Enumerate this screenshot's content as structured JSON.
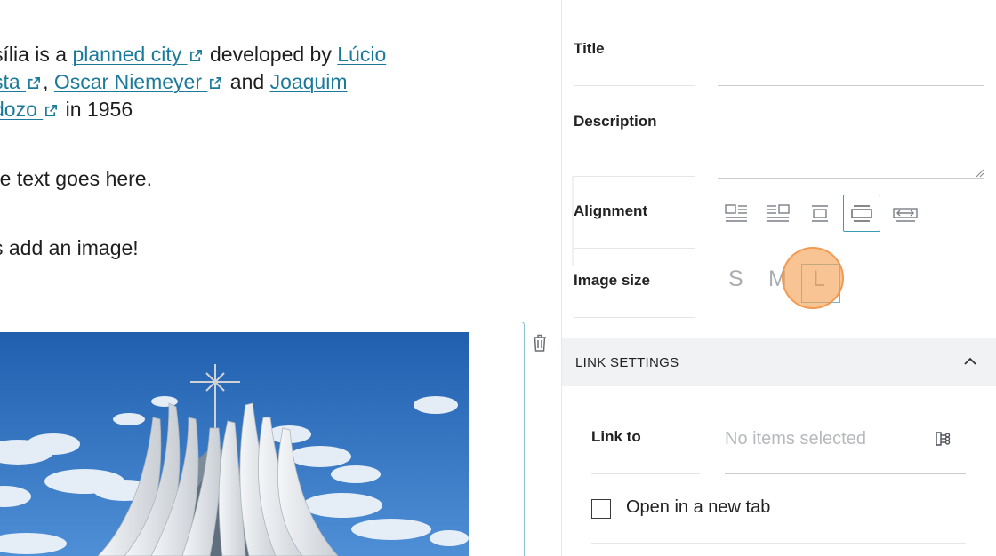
{
  "editor": {
    "para1_line1": {
      "t1": "sília is a ",
      "link1": "planned city ",
      "t2": " developed by ",
      "link2": "Lúcio "
    },
    "para1_line2": {
      "link1": "sta ",
      "t1": ", ",
      "link2": "Oscar Niemeyer ",
      "t2": " and ",
      "link3": "Joaquim "
    },
    "para1_line3": {
      "link1": "dozo ",
      "t1": " in 1956"
    },
    "para2": "re text goes here.",
    "para3": "s add an image!"
  },
  "sidebar": {
    "title_label": "Title",
    "description_label": "Description",
    "alignment_label": "Alignment",
    "alignment_options": [
      "align-left-icon",
      "align-right-icon",
      "align-center-icon",
      "align-wide-icon",
      "align-full-icon"
    ],
    "alignment_selected": "align-wide-icon",
    "image_size_label": "Image size",
    "sizes": {
      "s": "S",
      "m": "M",
      "l": "L"
    },
    "size_selected": "L",
    "link_settings": {
      "title": "LINK SETTINGS",
      "link_to_label": "Link to",
      "link_to_placeholder": "No items selected",
      "open_new_tab_label": "Open in a new tab"
    }
  },
  "colors": {
    "link": "#1b7a99",
    "accent": "#3b9bb5",
    "click_indicator": "#f6a050"
  }
}
